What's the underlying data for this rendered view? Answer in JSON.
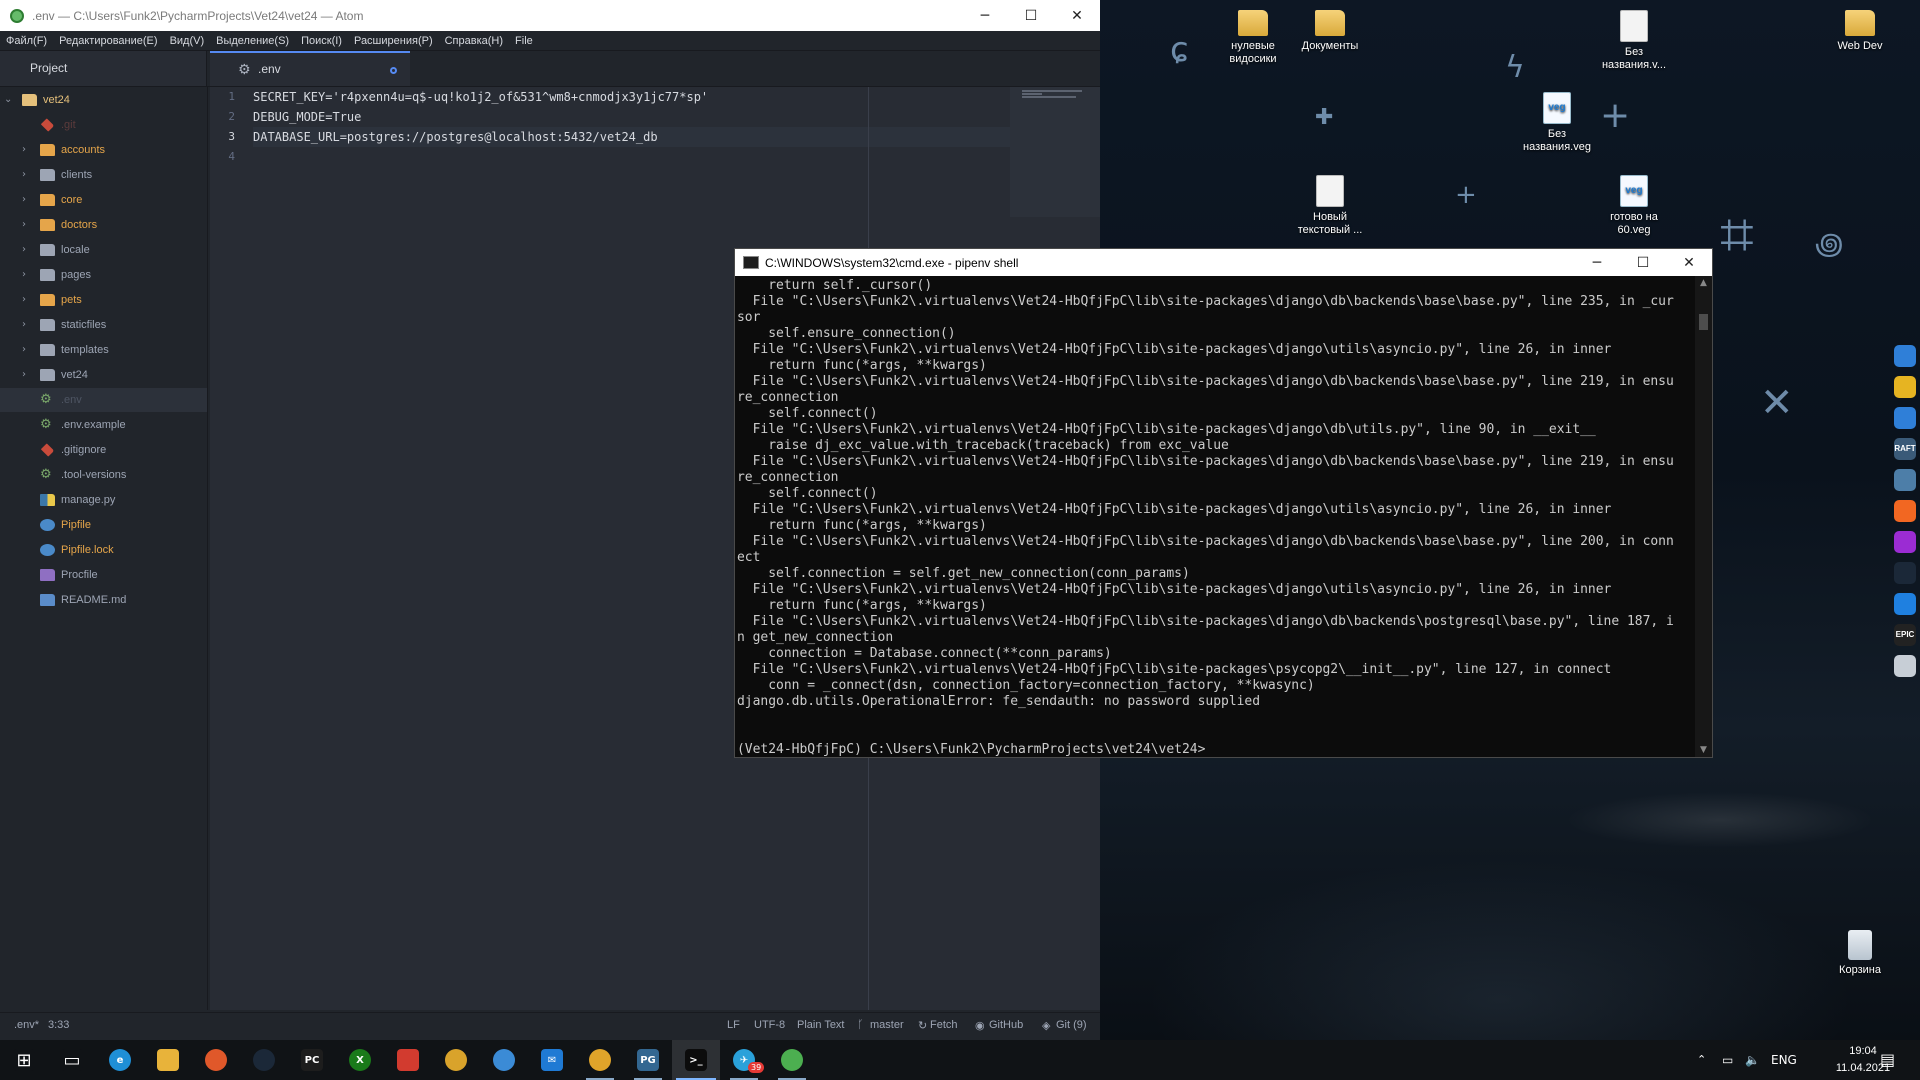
{
  "desktop": {
    "icons": [
      {
        "label": "нулевые видосики",
        "kind": "folder"
      },
      {
        "label": "Документы",
        "kind": "folder"
      },
      {
        "label": "Без названия.v...",
        "kind": "file"
      },
      {
        "label": "Web Dev",
        "kind": "folder"
      },
      {
        "label": "Без названия.veg",
        "kind": "veg"
      },
      {
        "label": "Новый текстовый ...",
        "kind": "file"
      },
      {
        "label": "готово на 60.veg",
        "kind": "veg"
      },
      {
        "label": "Корзина",
        "kind": "bin"
      }
    ],
    "veg_glyph": "veg",
    "side_apps": [
      {
        "name": "mail-icon",
        "color": "#2f7fd8",
        "text": ""
      },
      {
        "name": "notes-icon",
        "color": "#e6b422",
        "text": ""
      },
      {
        "name": "onedrive-icon",
        "color": "#2f7fd8",
        "text": ""
      },
      {
        "name": "raft-icon",
        "color": "#3a5a78",
        "text": "RAFT"
      },
      {
        "name": "photos-icon",
        "color": "#4d7ea8",
        "text": ""
      },
      {
        "name": "origin-icon",
        "color": "#f26722",
        "text": ""
      },
      {
        "name": "opera-icon",
        "color": "#9b2cd3",
        "text": ""
      },
      {
        "name": "steam-icon",
        "color": "#1b2838",
        "text": ""
      },
      {
        "name": "uplay-icon",
        "color": "#1f80e0",
        "text": ""
      },
      {
        "name": "epic-icon",
        "color": "#222222",
        "text": "EPIC"
      },
      {
        "name": "recycle-icon",
        "color": "#c7ced6",
        "text": ""
      }
    ]
  },
  "atom": {
    "title": ".env — C:\\Users\\Funk2\\PycharmProjects\\Vet24\\vet24 — Atom",
    "menu": [
      "Файл(F)",
      "Редактирование(E)",
      "Вид(V)",
      "Выделение(S)",
      "Поиск(I)",
      "Расширения(P)",
      "Справка(H)",
      "File"
    ],
    "tree_tab": "Project",
    "file_tab": ".env",
    "tree": [
      {
        "label": "vet24",
        "type": "root",
        "color": "#e5c07b"
      },
      {
        "label": ".git",
        "type": "git",
        "color": "#5c3b3b"
      },
      {
        "label": "accounts",
        "type": "folder",
        "color": "#e5a54a"
      },
      {
        "label": "clients",
        "type": "folder",
        "color": "#9da5b4"
      },
      {
        "label": "core",
        "type": "folder",
        "color": "#e5a54a"
      },
      {
        "label": "doctors",
        "type": "folder",
        "color": "#e5a54a"
      },
      {
        "label": "locale",
        "type": "folder",
        "color": "#9da5b4"
      },
      {
        "label": "pages",
        "type": "folder",
        "color": "#9da5b4"
      },
      {
        "label": "pets",
        "type": "folder",
        "color": "#e5a54a"
      },
      {
        "label": "staticfiles",
        "type": "folder",
        "color": "#9da5b4"
      },
      {
        "label": "templates",
        "type": "folder",
        "color": "#9da5b4"
      },
      {
        "label": "vet24",
        "type": "folder",
        "color": "#9da5b4"
      },
      {
        "label": ".env",
        "type": "gear",
        "color": "#4e5563"
      },
      {
        "label": ".env.example",
        "type": "gear",
        "color": "#9da5b4"
      },
      {
        "label": ".gitignore",
        "type": "git",
        "color": "#9da5b4"
      },
      {
        "label": ".tool-versions",
        "type": "gear",
        "color": "#9da5b4"
      },
      {
        "label": "manage.py",
        "type": "python",
        "color": "#9da5b4"
      },
      {
        "label": "Pipfile",
        "type": "pip",
        "color": "#e5a54a"
      },
      {
        "label": "Pipfile.lock",
        "type": "pip",
        "color": "#e5a54a"
      },
      {
        "label": "Procfile",
        "type": "heroku",
        "color": "#9da5b4"
      },
      {
        "label": "README.md",
        "type": "md",
        "color": "#9da5b4"
      }
    ],
    "code": [
      "SECRET_KEY='r4pxenn4u=q$-uq!ko1j2_of&531^wm8+cnmodjx3y1jc77*sp'",
      "DEBUG_MODE=True",
      "DATABASE_URL=postgres://postgres@localhost:5432/vet24_db",
      ""
    ],
    "line_numbers": [
      "1",
      "2",
      "3",
      "4"
    ],
    "status": {
      "file": ".env*",
      "cursor": "3:33",
      "eol": "LF",
      "encoding": "UTF-8",
      "grammar": "Plain Text",
      "branch": "master",
      "fetch": "Fetch",
      "github": "GitHub",
      "git": "Git (9)"
    }
  },
  "cmd": {
    "title": "C:\\WINDOWS\\system32\\cmd.exe - pipenv  shell",
    "lines": [
      "    return self._cursor()",
      "  File \"C:\\Users\\Funk2\\.virtualenvs\\Vet24-HbQfjFpC\\lib\\site-packages\\django\\db\\backends\\base\\base.py\", line 235, in _cur",
      "sor",
      "    self.ensure_connection()",
      "  File \"C:\\Users\\Funk2\\.virtualenvs\\Vet24-HbQfjFpC\\lib\\site-packages\\django\\utils\\asyncio.py\", line 26, in inner",
      "    return func(*args, **kwargs)",
      "  File \"C:\\Users\\Funk2\\.virtualenvs\\Vet24-HbQfjFpC\\lib\\site-packages\\django\\db\\backends\\base\\base.py\", line 219, in ensu",
      "re_connection",
      "    self.connect()",
      "  File \"C:\\Users\\Funk2\\.virtualenvs\\Vet24-HbQfjFpC\\lib\\site-packages\\django\\db\\utils.py\", line 90, in __exit__",
      "    raise dj_exc_value.with_traceback(traceback) from exc_value",
      "  File \"C:\\Users\\Funk2\\.virtualenvs\\Vet24-HbQfjFpC\\lib\\site-packages\\django\\db\\backends\\base\\base.py\", line 219, in ensu",
      "re_connection",
      "    self.connect()",
      "  File \"C:\\Users\\Funk2\\.virtualenvs\\Vet24-HbQfjFpC\\lib\\site-packages\\django\\utils\\asyncio.py\", line 26, in inner",
      "    return func(*args, **kwargs)",
      "  File \"C:\\Users\\Funk2\\.virtualenvs\\Vet24-HbQfjFpC\\lib\\site-packages\\django\\db\\backends\\base\\base.py\", line 200, in conn",
      "ect",
      "    self.connection = self.get_new_connection(conn_params)",
      "  File \"C:\\Users\\Funk2\\.virtualenvs\\Vet24-HbQfjFpC\\lib\\site-packages\\django\\utils\\asyncio.py\", line 26, in inner",
      "    return func(*args, **kwargs)",
      "  File \"C:\\Users\\Funk2\\.virtualenvs\\Vet24-HbQfjFpC\\lib\\site-packages\\django\\db\\backends\\postgresql\\base.py\", line 187, i",
      "n get_new_connection",
      "    connection = Database.connect(**conn_params)",
      "  File \"C:\\Users\\Funk2\\.virtualenvs\\Vet24-HbQfjFpC\\lib\\site-packages\\psycopg2\\__init__.py\", line 127, in connect",
      "    conn = _connect(dsn, connection_factory=connection_factory, **kwasync)",
      "django.db.utils.OperationalError: fe_sendauth: no password supplied",
      "",
      "",
      "(Vet24-HbQfjFpC) C:\\Users\\Funk2\\PycharmProjects\\vet24\\vet24>"
    ]
  },
  "taskbar": {
    "apps": [
      {
        "name": "start-button",
        "color": "#101316",
        "text": "⊞"
      },
      {
        "name": "task-view-button",
        "color": "#101316",
        "text": "▭"
      },
      {
        "name": "edge-taskbar-icon",
        "color": "#1f8fd6",
        "text": "e"
      },
      {
        "name": "explorer-taskbar-icon",
        "color": "#e8b33a",
        "text": ""
      },
      {
        "name": "firefox-taskbar-icon",
        "color": "#e0582a",
        "text": ""
      },
      {
        "name": "steam-taskbar-icon",
        "color": "#1b2838",
        "text": ""
      },
      {
        "name": "pycharm-taskbar-icon",
        "color": "#1d1d1d",
        "text": "PC"
      },
      {
        "name": "xbox-taskbar-icon",
        "color": "#1a7a1a",
        "text": "X"
      },
      {
        "name": "crossover-taskbar-icon",
        "color": "#d23b2f",
        "text": ""
      },
      {
        "name": "chrome-taskbar-icon",
        "color": "#d9a32b",
        "text": ""
      },
      {
        "name": "drop-taskbar-icon",
        "color": "#3b8bd6",
        "text": ""
      },
      {
        "name": "mail-taskbar-icon",
        "color": "#1f7ad4",
        "text": "✉"
      },
      {
        "name": "chrome-running-taskbar-icon",
        "color": "#e0a42a",
        "text": ""
      },
      {
        "name": "postgres-taskbar-icon",
        "color": "#336791",
        "text": "PG"
      },
      {
        "name": "cmd-taskbar-icon",
        "color": "#0c0c0c",
        "text": ">_"
      },
      {
        "name": "telegram-taskbar-icon",
        "color": "#2aa1da",
        "text": "✈"
      },
      {
        "name": "atom-taskbar-icon",
        "color": "#4caf50",
        "text": ""
      }
    ],
    "telegram_badge": "39",
    "lang": "ENG",
    "time": "19:04",
    "date": "11.04.2021"
  }
}
